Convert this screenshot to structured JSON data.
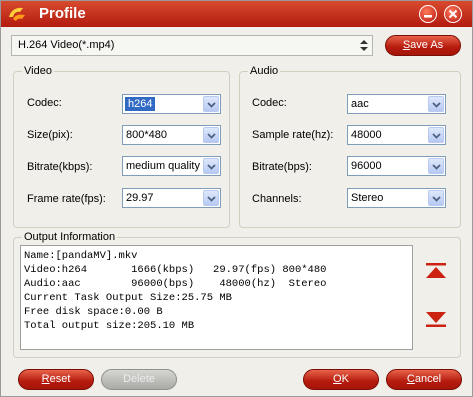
{
  "window": {
    "title": "Profile"
  },
  "format": {
    "selected": "H.264 Video(*.mp4)",
    "save_as_label": "Save As",
    "save_as_mnemonic": "S",
    "save_as_rest": "ave As"
  },
  "video": {
    "group_title": "Video",
    "codec": {
      "label": "Codec:",
      "value": "h264"
    },
    "size": {
      "label": "Size(pix):",
      "value": "800*480"
    },
    "bitrate": {
      "label": "Bitrate(kbps):",
      "value": "medium quality"
    },
    "frame_rate": {
      "label": "Frame rate(fps):",
      "value": "29.97"
    }
  },
  "audio": {
    "group_title": "Audio",
    "codec": {
      "label": "Codec:",
      "value": "aac"
    },
    "sample_rate": {
      "label": "Sample rate(hz):",
      "value": "48000"
    },
    "bitrate": {
      "label": "Bitrate(bps):",
      "value": "96000"
    },
    "channels": {
      "label": "Channels:",
      "value": "Stereo"
    }
  },
  "output": {
    "group_title": "Output Information",
    "lines": [
      "Name:[pandaMV].mkv",
      "Video:h264       1666(kbps)   29.97(fps) 800*480",
      "Audio:aac        96000(bps)    48000(hz)  Stereo",
      "Current Task Output Size:25.75 MB",
      "Free disk space:0.00 B",
      "Total output size:205.10 MB"
    ]
  },
  "buttons": {
    "reset": {
      "mnemonic": "R",
      "rest": "eset"
    },
    "delete": {
      "label": "Delete"
    },
    "ok": {
      "mnemonic": "O",
      "rest": "K"
    },
    "cancel": {
      "mnemonic": "C",
      "rest": "ancel"
    }
  },
  "colors": {
    "accent": "#c0281a",
    "title_bar": "#c53320",
    "selection": "#316ac5"
  },
  "icons": [
    "app-logo-icon",
    "minimize-icon",
    "close-icon",
    "chevron-down-icon",
    "move-up-icon",
    "move-down-icon"
  ]
}
